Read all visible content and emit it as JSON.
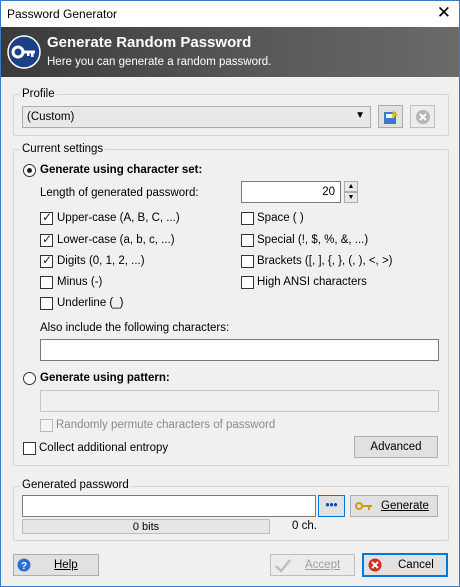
{
  "window": {
    "title": "Password Generator",
    "close_glyph": "✕"
  },
  "banner": {
    "title": "Generate Random Password",
    "subtitle": "Here you can generate a random password.",
    "icon": "key-icon"
  },
  "profile": {
    "group_label": "Profile",
    "selected": "(Custom)",
    "save_icon": "save-profile-icon",
    "delete_icon": "delete-profile-icon"
  },
  "settings": {
    "group_label": "Current settings",
    "charset_radio": "Generate using character set:",
    "length_label": "Length of generated password:",
    "length_value": "20",
    "options": [
      {
        "label": "Upper-case (A, B, C, ...)",
        "checked": true
      },
      {
        "label": "Lower-case (a, b, c, ...)",
        "checked": true
      },
      {
        "label": "Digits (0, 1, 2, ...)",
        "checked": true
      },
      {
        "label": "Minus (-)",
        "checked": false
      },
      {
        "label": "Underline (_)",
        "checked": false
      },
      {
        "label": "Space ( )",
        "checked": false
      },
      {
        "label": "Special (!, $, %, &, ...)",
        "checked": false
      },
      {
        "label": "Brackets ([, ], {, }, (, ), <, >)",
        "checked": false
      },
      {
        "label": "High ANSI characters",
        "checked": false
      }
    ],
    "include_label": "Also include the following characters:",
    "include_value": "",
    "pattern_radio": "Generate using pattern:",
    "pattern_value": "",
    "permute_label": "Randomly permute characters of password",
    "entropy_label": "Collect additional entropy",
    "advanced_button": "Advanced"
  },
  "generated": {
    "group_label": "Generated password",
    "value": "",
    "dots_label": "•••",
    "generate_button": "Generate",
    "bits_label": "0 bits",
    "chars_label": "0 ch."
  },
  "footer": {
    "help": "Help",
    "accept": "Accept",
    "cancel": "Cancel"
  },
  "colors": {
    "accent": "#0078d7",
    "banner": "#4a4a4a"
  }
}
